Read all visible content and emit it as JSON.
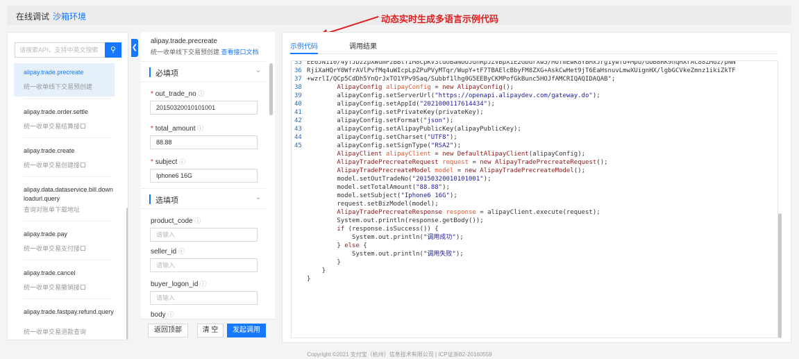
{
  "topbar": {
    "tab_online": "在线调试",
    "tab_sandbox": "沙箱环境"
  },
  "annotation": {
    "text": "动态实时生成多语言示例代码"
  },
  "search": {
    "placeholder": "请搜索API，支持中英文搜索"
  },
  "api_list": [
    {
      "name": "alipay.trade.precreate",
      "desc": "统一收单线下交易预创建",
      "selected": true
    },
    {
      "name": "alipay.trade.order.settle",
      "desc": "统一收单交易结算接口"
    },
    {
      "name": "alipay.trade.create",
      "desc": "统一收单交易创建接口"
    },
    {
      "name": "alipay.data.dataservice.bill.downloadurl.query",
      "desc": "查询对账单下载地址"
    },
    {
      "name": "alipay.trade.pay",
      "desc": "统一收单交易支付接口"
    },
    {
      "name": "alipay.trade.cancel",
      "desc": "统一收单交易撤销接口"
    },
    {
      "name": "alipay.trade.fastpay.refund.query",
      "desc": "统一收单交易退款查询"
    }
  ],
  "params": {
    "title": "alipay.trade.precreate",
    "subtitle": "统一收单线下交易预创建",
    "doc_link": "查看接口文档",
    "required_section": "必填项",
    "optional_section": "选填项",
    "required_fields": [
      {
        "label": "out_trade_no",
        "value": "20150320010101001"
      },
      {
        "label": "total_amount",
        "value": "88.88"
      },
      {
        "label": "subject",
        "value": "Iphone6 16G"
      }
    ],
    "optional_fields": [
      {
        "label": "product_code",
        "placeholder": "请输入"
      },
      {
        "label": "seller_id",
        "placeholder": "请输入"
      },
      {
        "label": "buyer_logon_id",
        "placeholder": "请输入"
      },
      {
        "label": "body"
      }
    ],
    "buttons": {
      "back_top": "返回顶部",
      "clear": "清 空",
      "invoke": "发起调用"
    }
  },
  "code_panel": {
    "tab_example": "示例代码",
    "tab_result": "调用结果",
    "lines": [
      {
        "n": "35",
        "text": "EE6JN1I0/4yTJDzzpXWumPzBBtTIM8CpKV3tdoBaNUUJGhRpJZVBpXIE2GbGrXw5/MUTmEwK8YBMxJrg1ywfU+MpU/GUB8RK9nqMXrAC88ZMGz/pNN"
      },
      {
        "n": "36",
        "text": "RjiXaHQrY0WfrAVlPvfMq4uWIcpLpZPuPVyMTqr/WupY+tF7TBAElcBbyFM8ZXG+AskCwHet9jT6EaHsnuvLmwXUignHX/lgbGCVkeZmnz1ikiZkTF"
      },
      {
        "n": "37",
        "text": "+wzrlI/QCp5CdDh5YnQrJxTO1YPv9Saq/Subbf1lhg0G5EEByCKMPofGkBunc5HOJfAMCRIQAQIDAQAB\";"
      },
      {
        "n": "38",
        "text": "        AlipayConfig alipayConfig = new AlipayConfig();"
      },
      {
        "n": "39",
        "text": "        alipayConfig.setServerUrl(\"https://openapi.alipaydev.com/gateway.do\");"
      },
      {
        "n": "40",
        "text": "        alipayConfig.setAppId(\"2021000117614434\");"
      },
      {
        "n": "41",
        "text": "        alipayConfig.setPrivateKey(privateKey);"
      },
      {
        "n": "42",
        "text": "        alipayConfig.setFormat(\"json\");"
      },
      {
        "n": "43",
        "text": "        alipayConfig.setAlipayPublicKey(alipayPublicKey);"
      },
      {
        "n": "44",
        "text": "        alipayConfig.setCharset(\"UTF8\");"
      },
      {
        "n": "45",
        "text": "        alipayConfig.setSignType(\"RSA2\");"
      },
      {
        "n": "",
        "text": "        AlipayClient alipayClient = new DefaultAlipayClient(alipayConfig);"
      },
      {
        "n": "",
        "text": "        AlipayTradePrecreateRequest request = new AlipayTradePrecreateRequest();"
      },
      {
        "n": "",
        "text": "        AlipayTradePrecreateModel model = new AlipayTradePrecreateModel();"
      },
      {
        "n": "",
        "text": "        model.setOutTradeNo(\"20150320010101001\");"
      },
      {
        "n": "",
        "text": "        model.setTotalAmount(\"88.88\");"
      },
      {
        "n": "",
        "text": "        model.setSubject(\"Iphone6 16G\");"
      },
      {
        "n": "",
        "text": "        request.setBizModel(model);"
      },
      {
        "n": "",
        "text": "        AlipayTradePrecreateResponse response = alipayClient.execute(request);"
      },
      {
        "n": "",
        "text": "        System.out.println(response.getBody());"
      },
      {
        "n": "",
        "text": "        if (response.isSuccess()) {"
      },
      {
        "n": "",
        "text": "            System.out.println(\"调用成功\");"
      },
      {
        "n": "",
        "text": "        } else {"
      },
      {
        "n": "",
        "text": "            System.out.println(\"调用失败\");"
      },
      {
        "n": "",
        "text": "        }"
      },
      {
        "n": "",
        "text": "    }"
      },
      {
        "n": "",
        "text": "}"
      }
    ]
  },
  "footer": {
    "text": "Copyright ©2021 支付宝（杭州）信息技术有限公司 | ICP证浙B2-20160559"
  }
}
